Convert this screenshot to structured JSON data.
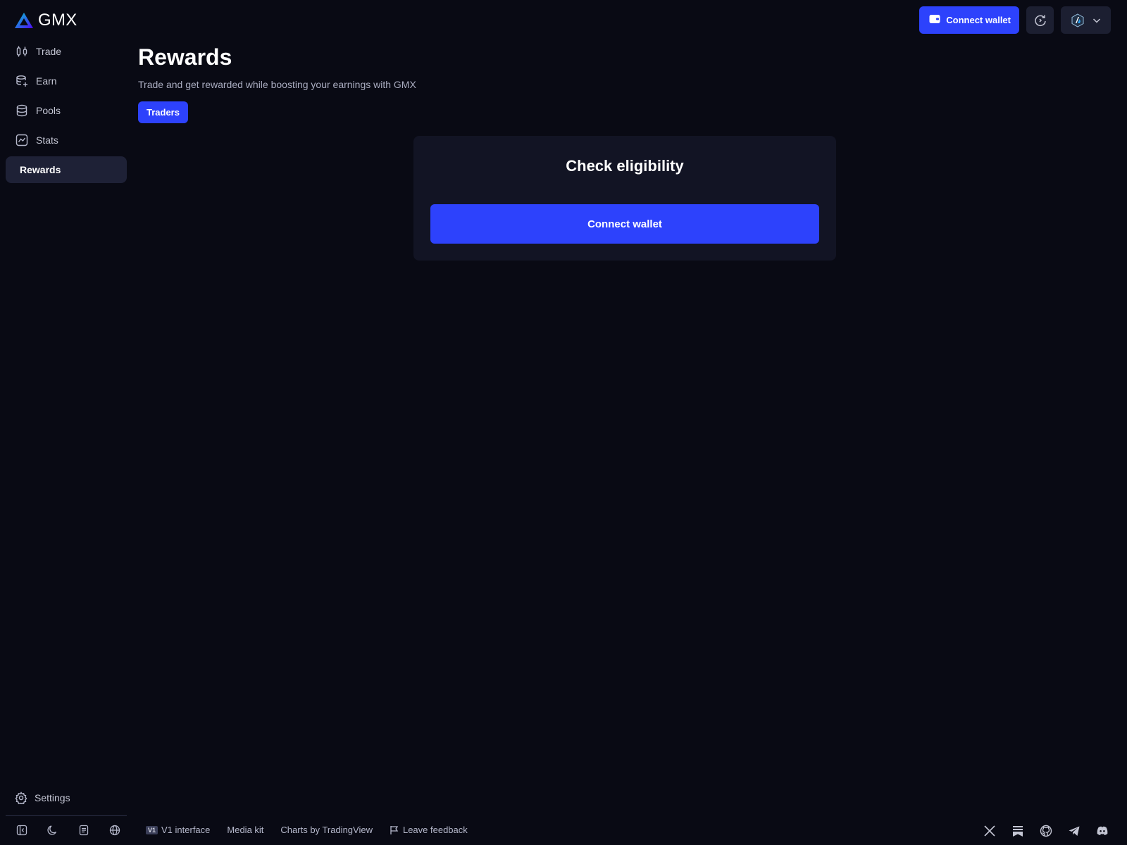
{
  "brand": {
    "name": "GMX"
  },
  "nav": {
    "items": [
      {
        "label": "Trade",
        "icon": "candles-icon"
      },
      {
        "label": "Earn",
        "icon": "earn-icon"
      },
      {
        "label": "Pools",
        "icon": "database-icon"
      },
      {
        "label": "Stats",
        "icon": "stats-chart-icon"
      },
      {
        "label": "Rewards",
        "icon": "",
        "active": true
      }
    ],
    "settings_label": "Settings"
  },
  "header": {
    "connect_label": "Connect wallet"
  },
  "page": {
    "title": "Rewards",
    "subtitle": "Trade and get rewarded while boosting your earnings with GMX",
    "tab_label": "Traders"
  },
  "card": {
    "title": "Check eligibility",
    "button_label": "Connect wallet"
  },
  "footer": {
    "v1_badge": "V1",
    "v1_label": "V1 interface",
    "media_kit": "Media kit",
    "charts": "Charts by TradingView",
    "feedback": "Leave feedback"
  },
  "colors": {
    "background": "#090a14",
    "accent": "#2d42fc",
    "card": "#121424",
    "nav_active": "#1e2136"
  }
}
